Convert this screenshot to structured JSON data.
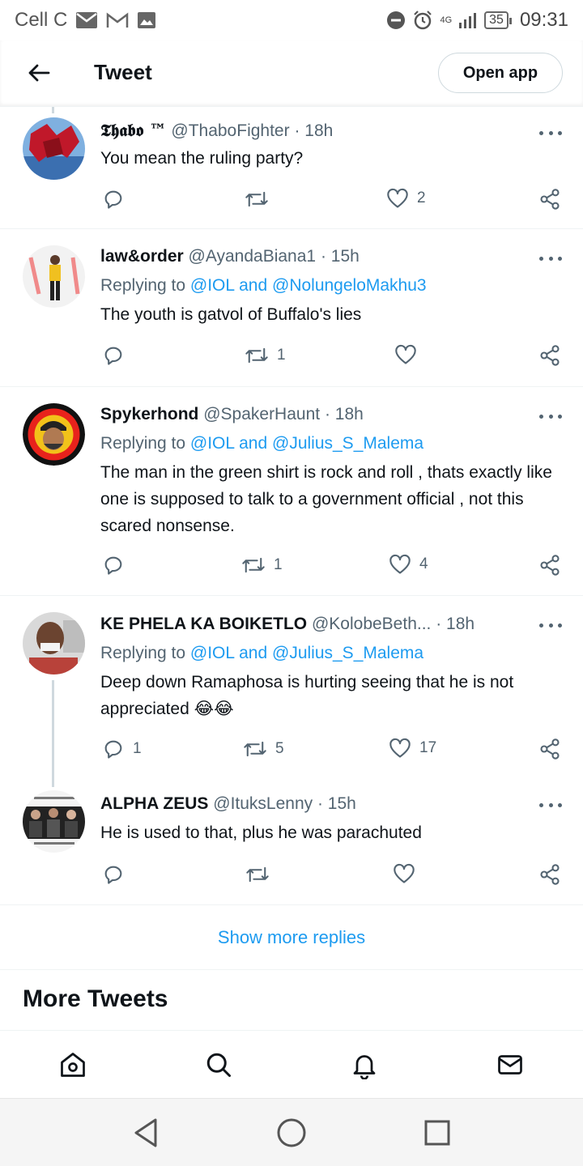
{
  "status_bar": {
    "carrier": "Cell C",
    "network": "4G",
    "battery": "35",
    "time": "09:31"
  },
  "header": {
    "title": "Tweet",
    "open_app_label": "Open app"
  },
  "tweets": [
    {
      "name": "𝕿𝖍𝖆𝖇𝖔 ™",
      "handle": "@ThaboFighter",
      "time": "· 18h",
      "replying": null,
      "text": "You mean the ruling party?",
      "replies": "",
      "retweets": "",
      "likes": "2"
    },
    {
      "name": "law&order",
      "handle": "@AyandaBiana1",
      "time": "· 15h",
      "replying_prefix": "Replying to",
      "replying_to": "@IOL and @NolungeloMakhu3",
      "text": "The youth is gatvol of Buffalo's lies",
      "replies": "",
      "retweets": "1",
      "likes": ""
    },
    {
      "name": "Spykerhond",
      "handle": "@SpakerHaunt",
      "time": "· 18h",
      "replying_prefix": "Replying to",
      "replying_to": "@IOL and @Julius_S_Malema",
      "text": "The man in the green shirt is rock and roll , thats exactly like one is supposed to talk to a government official , not this scared nonsense.",
      "replies": "",
      "retweets": "1",
      "likes": "4"
    },
    {
      "name": "KE PHELA KA BOIKETLO",
      "handle": "@KolobeBeth...",
      "time": "· 18h",
      "replying_prefix": "Replying to",
      "replying_to": "@IOL and @Julius_S_Malema",
      "text": "Deep down Ramaphosa is hurting seeing that he is not appreciated 😂😂",
      "replies": "1",
      "retweets": "5",
      "likes": "17"
    },
    {
      "name": "ALPHA ZEUS",
      "handle": "@ItuksLenny",
      "time": "· 15h",
      "replying": null,
      "text": "He is used to that, plus he was parachuted",
      "replies": "",
      "retweets": "",
      "likes": ""
    }
  ],
  "show_more_label": "Show more replies",
  "more_tweets_heading": "More Tweets",
  "colors": {
    "link": "#1d9bf0",
    "secondary_text": "#536471",
    "primary_text": "#0f1419"
  },
  "icons": {
    "back": "arrow-left-icon",
    "reply": "reply-icon",
    "retweet": "retweet-icon",
    "like": "heart-icon",
    "share": "share-icon",
    "home": "home-icon",
    "search": "search-icon",
    "notifications": "bell-icon",
    "messages": "mail-icon"
  }
}
